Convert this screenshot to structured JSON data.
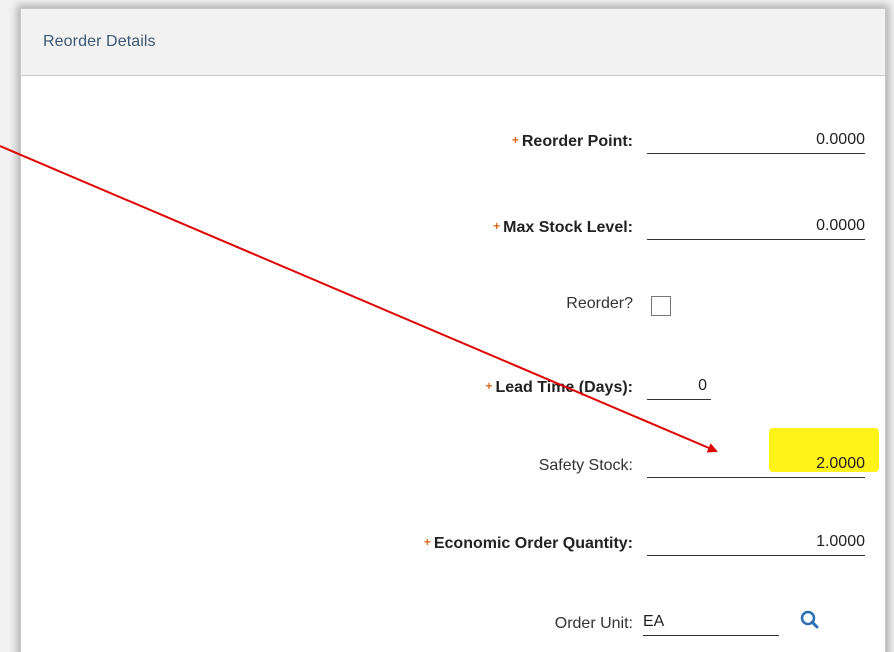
{
  "panel": {
    "title": "Reorder Details"
  },
  "fields": {
    "reorder_point": {
      "label": "Reorder Point:",
      "value": "0.0000",
      "required": true
    },
    "max_stock_level": {
      "label": "Max Stock Level:",
      "value": "0.0000",
      "required": true
    },
    "reorder": {
      "label": "Reorder?",
      "checked": false
    },
    "lead_time": {
      "label": "Lead Time (Days):",
      "value": "0",
      "required": true
    },
    "safety_stock": {
      "label": "Safety Stock:",
      "value": "2.0000",
      "required": false
    },
    "economic_order_quantity": {
      "label": "Economic Order Quantity:",
      "value": "1.0000",
      "required": true
    },
    "order_unit": {
      "label": "Order Unit:",
      "value": "EA",
      "required": false
    }
  },
  "required_marker": "+",
  "colors": {
    "required_marker": "#e06a1f",
    "header_text": "#3d5875",
    "highlight": "#fff200",
    "annotation_arrow": "#e00000",
    "lookup_icon": "#2f6fb5"
  },
  "icons": {
    "lookup": "search-icon",
    "annotation": "red-arrow"
  }
}
